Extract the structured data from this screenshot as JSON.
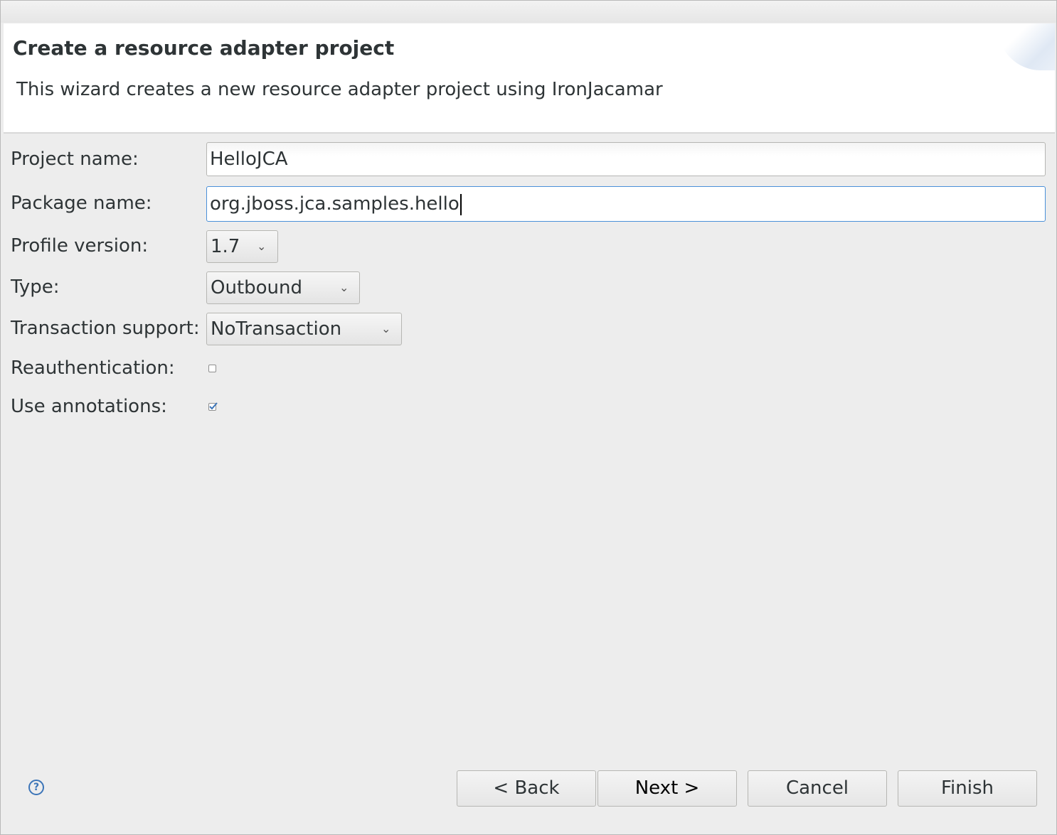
{
  "header": {
    "title": "Create a resource adapter project",
    "description": "This wizard creates a new resource adapter project using IronJacamar"
  },
  "form": {
    "project_name": {
      "label": "Project name:",
      "value": "HelloJCA"
    },
    "package_name": {
      "label": "Package name:",
      "value": "org.jboss.jca.samples.hello"
    },
    "profile_version": {
      "label": "Profile version:",
      "value": "1.7"
    },
    "type": {
      "label": "Type:",
      "value": "Outbound"
    },
    "transaction_support": {
      "label": "Transaction support:",
      "value": "NoTransaction"
    },
    "reauthentication": {
      "label": "Reauthentication:",
      "checked": false
    },
    "use_annotations": {
      "label": "Use annotations:",
      "checked": true
    }
  },
  "footer": {
    "help_icon": "help-icon",
    "back_label": "< Back",
    "next_label": "Next >",
    "cancel_label": "Cancel",
    "finish_label": "Finish"
  },
  "colors": {
    "accent": "#4a90d9",
    "background": "#ededed"
  }
}
